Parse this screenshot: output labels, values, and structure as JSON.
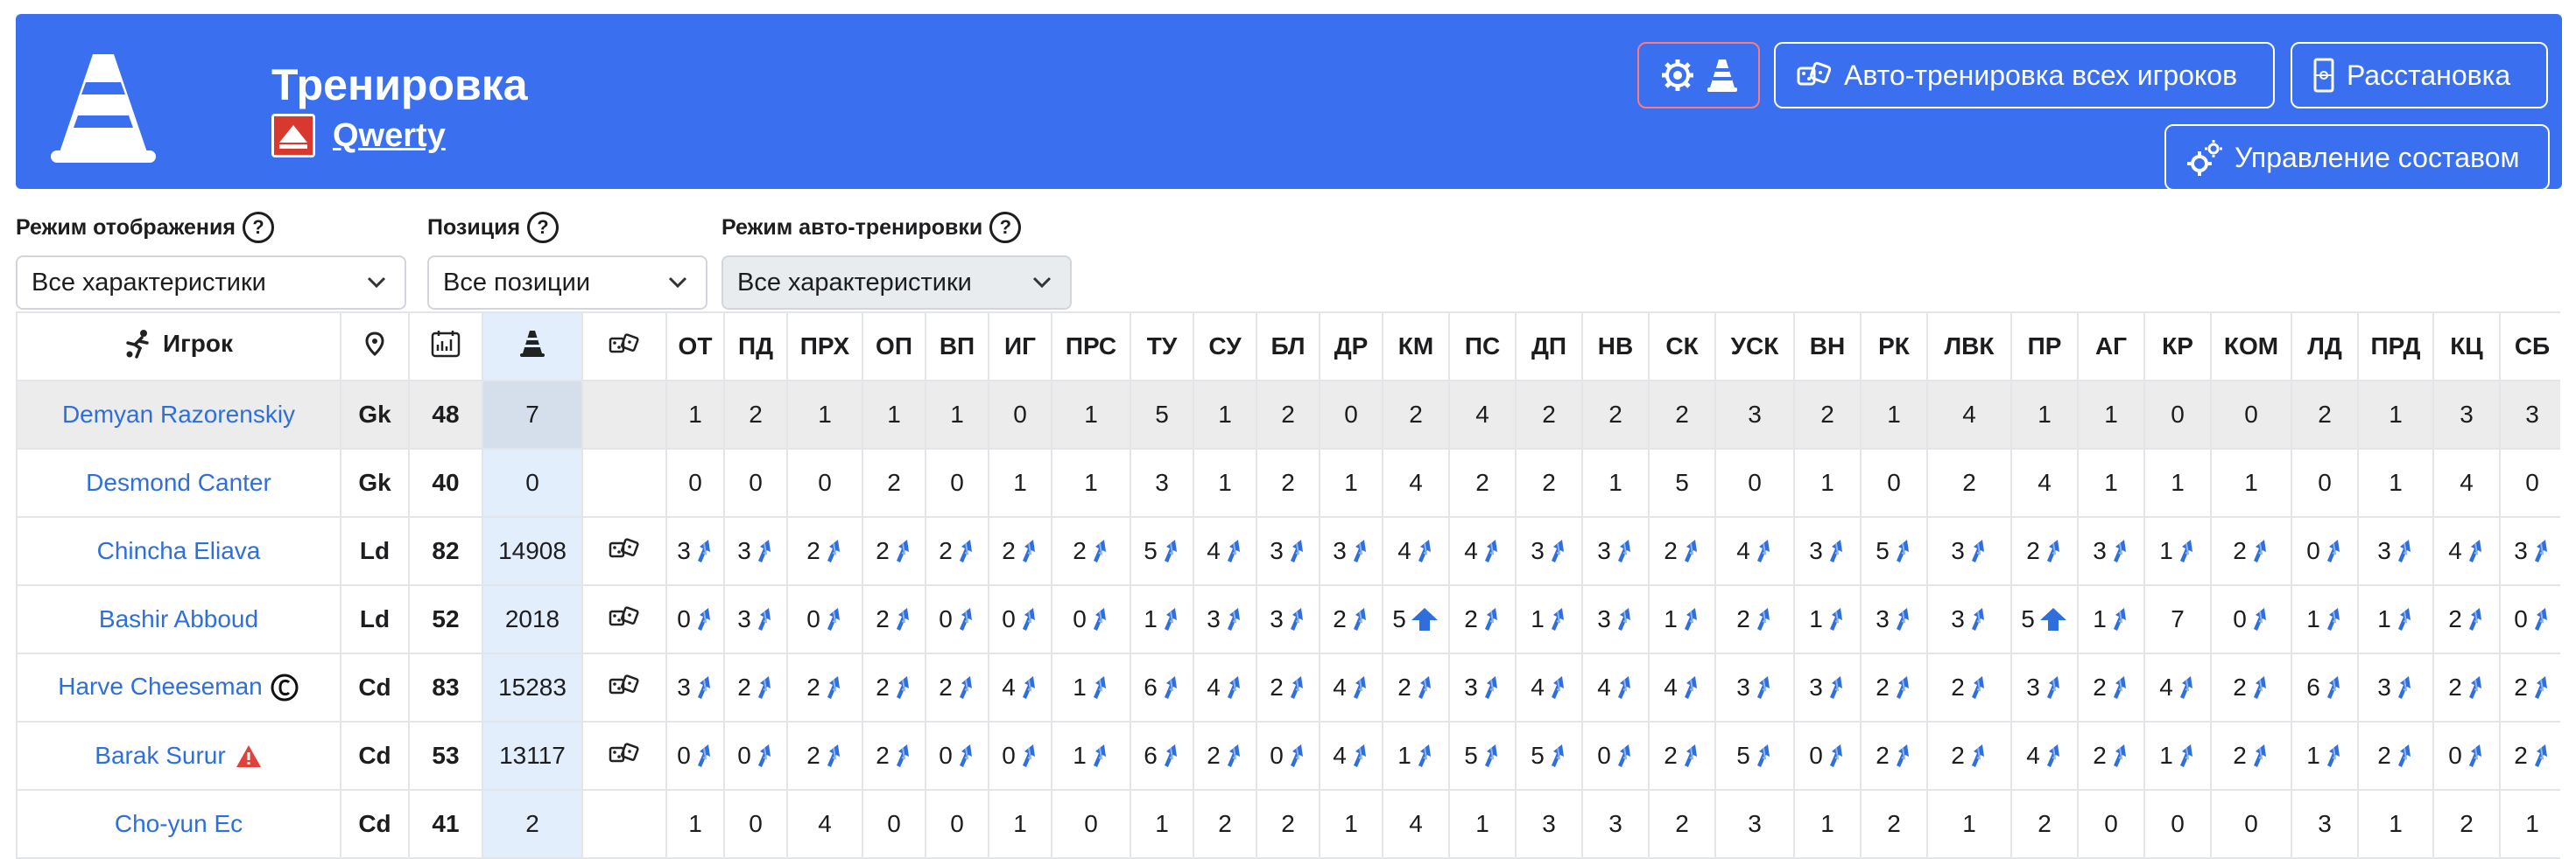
{
  "header": {
    "title": "Тренировка",
    "team_name": "Qwerty",
    "buttons": {
      "auto_train_all": "Авто-тренировка всех игроков",
      "formation": "Расстановка",
      "manage_squad": "Управление составом"
    }
  },
  "filters": {
    "display_mode": {
      "label": "Режим отображения",
      "value": "Все характеристики"
    },
    "position": {
      "label": "Позиция",
      "value": "Все позиции"
    },
    "auto_mode": {
      "label": "Режим авто-тренировки",
      "value": "Все характеристики"
    }
  },
  "colors": {
    "banner": "#3a6ff0",
    "link": "#2f6fdb",
    "train_column": "#e3eefc",
    "arrow": "#2f6fdb"
  },
  "table": {
    "player_header": "Игрок",
    "stat_headers": [
      "ОТ",
      "ПД",
      "ПРХ",
      "ОП",
      "ВП",
      "ИГ",
      "ПРС",
      "ТУ",
      "СУ",
      "БЛ",
      "ДР",
      "КМ",
      "ПС",
      "ДП",
      "НВ",
      "СК",
      "УСК",
      "ВН",
      "РК",
      "ЛВК",
      "ПР",
      "АГ",
      "КР",
      "КОМ",
      "ЛД",
      "ПРД",
      "КЦ",
      "СБ"
    ],
    "rows": [
      {
        "name": "Demyan Razorenskiy",
        "pos": "Gk",
        "age": "48",
        "train": "7",
        "auto": false,
        "badge": "",
        "highlight": true,
        "stats": [
          "1",
          "2",
          "1",
          "1",
          "1",
          "0",
          "1",
          "5",
          "1",
          "2",
          "0",
          "2",
          "4",
          "2",
          "2",
          "2",
          "3",
          "2",
          "1",
          "4",
          "1",
          "1",
          "0",
          "0",
          "2",
          "1",
          "3",
          "3"
        ],
        "arrows": []
      },
      {
        "name": "Desmond Canter",
        "pos": "Gk",
        "age": "40",
        "train": "0",
        "auto": false,
        "badge": "",
        "highlight": false,
        "stats": [
          "0",
          "0",
          "0",
          "2",
          "0",
          "1",
          "1",
          "3",
          "1",
          "2",
          "1",
          "4",
          "2",
          "2",
          "1",
          "5",
          "0",
          "1",
          "0",
          "2",
          "4",
          "1",
          "1",
          "1",
          "0",
          "1",
          "4",
          "0"
        ],
        "arrows": []
      },
      {
        "name": "Chincha Eliava",
        "pos": "Ld",
        "age": "82",
        "train": "14908",
        "auto": true,
        "badge": "",
        "highlight": false,
        "stats": [
          "3",
          "3",
          "2",
          "2",
          "2",
          "2",
          "2",
          "5",
          "4",
          "3",
          "3",
          "4",
          "4",
          "3",
          "3",
          "2",
          "4",
          "3",
          "5",
          "3",
          "2",
          "3",
          "1",
          "2",
          "0",
          "3",
          "4",
          "3"
        ],
        "arrows": [
          "up",
          "up",
          "up",
          "up",
          "up",
          "up",
          "up",
          "up",
          "up",
          "up",
          "up",
          "up",
          "up",
          "up",
          "up",
          "up",
          "up",
          "up",
          "up",
          "up",
          "up",
          "up",
          "up",
          "up",
          "up",
          "up",
          "up",
          "up"
        ]
      },
      {
        "name": "Bashir Abboud",
        "pos": "Ld",
        "age": "52",
        "train": "2018",
        "auto": true,
        "badge": "",
        "highlight": false,
        "stats": [
          "0",
          "3",
          "0",
          "2",
          "0",
          "0",
          "0",
          "1",
          "3",
          "3",
          "2",
          "5",
          "2",
          "1",
          "3",
          "1",
          "2",
          "1",
          "3",
          "3",
          "5",
          "1",
          "7",
          "0",
          "1",
          "1",
          "2",
          "0"
        ],
        "arrows": [
          "up",
          "up",
          "up",
          "up",
          "up",
          "up",
          "up",
          "up",
          "up",
          "up",
          "up",
          "big",
          "up",
          "up",
          "up",
          "up",
          "up",
          "up",
          "up",
          "up",
          "big",
          "up",
          "",
          "up",
          "up",
          "up",
          "up",
          "up"
        ]
      },
      {
        "name": "Harve Cheeseman",
        "pos": "Cd",
        "age": "83",
        "train": "15283",
        "auto": true,
        "badge": "captain",
        "highlight": false,
        "stats": [
          "3",
          "2",
          "2",
          "2",
          "2",
          "4",
          "1",
          "6",
          "4",
          "2",
          "4",
          "2",
          "3",
          "4",
          "4",
          "4",
          "3",
          "3",
          "2",
          "2",
          "3",
          "2",
          "4",
          "2",
          "6",
          "3",
          "2",
          "2"
        ],
        "arrows": [
          "up",
          "up",
          "up",
          "up",
          "up",
          "up",
          "up",
          "up",
          "up",
          "up",
          "up",
          "up",
          "up",
          "up",
          "up",
          "up",
          "up",
          "up",
          "up",
          "up",
          "up",
          "up",
          "up",
          "up",
          "up",
          "up",
          "up",
          "up"
        ]
      },
      {
        "name": "Barak Surur",
        "pos": "Cd",
        "age": "53",
        "train": "13117",
        "auto": true,
        "badge": "warning",
        "highlight": false,
        "stats": [
          "0",
          "0",
          "2",
          "2",
          "0",
          "0",
          "1",
          "6",
          "2",
          "0",
          "4",
          "1",
          "5",
          "5",
          "0",
          "2",
          "5",
          "0",
          "2",
          "2",
          "4",
          "2",
          "1",
          "2",
          "1",
          "2",
          "0",
          "2"
        ],
        "arrows": [
          "up",
          "up",
          "up",
          "up",
          "up",
          "up",
          "up",
          "up",
          "up",
          "up",
          "up",
          "up",
          "up",
          "up",
          "up",
          "up",
          "up",
          "up",
          "up",
          "up",
          "up",
          "up",
          "up",
          "up",
          "up",
          "up",
          "up",
          "up"
        ]
      },
      {
        "name": "Cho-yun Ec",
        "pos": "Cd",
        "age": "41",
        "train": "2",
        "auto": false,
        "badge": "",
        "highlight": false,
        "stats": [
          "1",
          "0",
          "4",
          "0",
          "0",
          "1",
          "0",
          "1",
          "2",
          "2",
          "1",
          "4",
          "1",
          "3",
          "3",
          "2",
          "3",
          "1",
          "2",
          "1",
          "2",
          "0",
          "0",
          "0",
          "3",
          "1",
          "2",
          "1"
        ],
        "arrows": []
      }
    ]
  }
}
